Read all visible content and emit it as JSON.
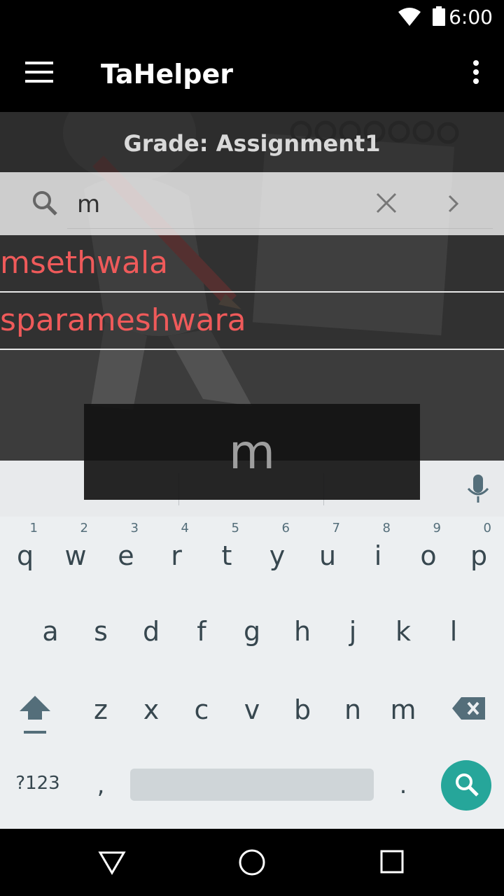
{
  "status_bar": {
    "time": "6:00",
    "icons": [
      "wifi-icon",
      "battery-icon"
    ]
  },
  "app_bar": {
    "title": "TaHelper",
    "menu_icon": "hamburger-menu-icon",
    "overflow_icon": "more-vert-icon"
  },
  "grade_header": {
    "text": "Grade: Assignment1"
  },
  "search": {
    "value": "m",
    "search_icon": "search-icon",
    "clear_icon": "close-icon",
    "go_icon": "chevron-right-icon"
  },
  "results": [
    {
      "label": "msethwala"
    },
    {
      "label": "sparameshwara"
    }
  ],
  "keyboard": {
    "key_preview": "m",
    "row1": [
      {
        "key": "q",
        "hint": "1"
      },
      {
        "key": "w",
        "hint": "2"
      },
      {
        "key": "e",
        "hint": "3"
      },
      {
        "key": "r",
        "hint": "4"
      },
      {
        "key": "t",
        "hint": "5"
      },
      {
        "key": "y",
        "hint": "6"
      },
      {
        "key": "u",
        "hint": "7"
      },
      {
        "key": "i",
        "hint": "8"
      },
      {
        "key": "o",
        "hint": "9"
      },
      {
        "key": "p",
        "hint": "0"
      }
    ],
    "row2": [
      "a",
      "s",
      "d",
      "f",
      "g",
      "h",
      "j",
      "k",
      "l"
    ],
    "row3": [
      "z",
      "x",
      "c",
      "v",
      "b",
      "n",
      "m"
    ],
    "symbols_label": "?123",
    "comma": ",",
    "period": ".",
    "icons": [
      "mic-icon",
      "shift-icon",
      "backspace-icon",
      "search-icon"
    ],
    "accent_color": "#26a69a"
  },
  "colors": {
    "result_text": "#ef5a5a",
    "bar_bg": "#000000"
  },
  "nav_bar": {
    "icons": [
      "back-icon",
      "home-icon",
      "recents-icon"
    ]
  }
}
